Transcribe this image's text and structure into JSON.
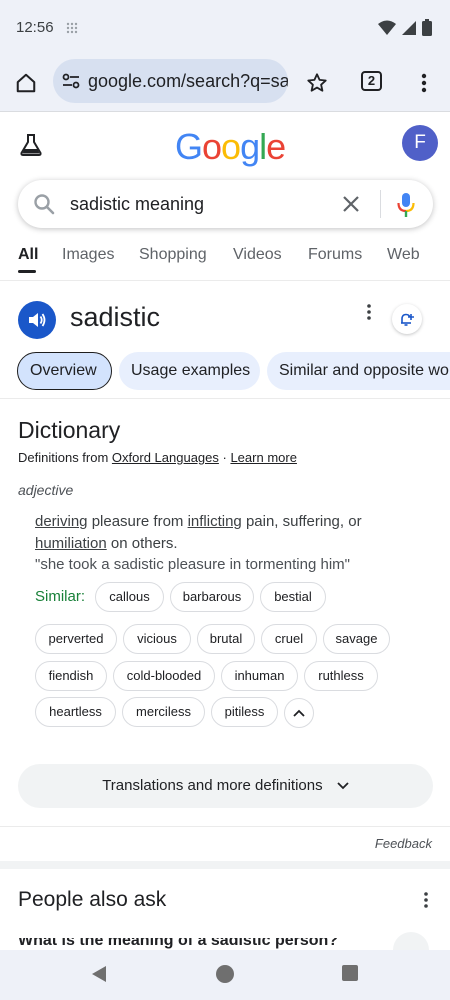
{
  "status": {
    "time": "12:56"
  },
  "browser": {
    "url": "google.com/search?q=sa",
    "tab_count": "2"
  },
  "google": {
    "logo": [
      "G",
      "o",
      "o",
      "g",
      "l",
      "e"
    ],
    "logo_colors": [
      "#4285F4",
      "#EA4335",
      "#FBBC05",
      "#4285F4",
      "#34A853",
      "#EA4335"
    ],
    "avatar_letter": "F"
  },
  "search": {
    "query": "sadistic meaning"
  },
  "tabs": [
    "All",
    "Images",
    "Shopping",
    "Videos",
    "Forums",
    "Web"
  ],
  "word": {
    "title": "sadistic",
    "chips": [
      "Overview",
      "Usage examples",
      "Similar and opposite wo"
    ]
  },
  "dictionary": {
    "title": "Dictionary",
    "source_prefix": "Definitions from ",
    "source": "Oxford Languages",
    "separator": " · ",
    "learn_more": "Learn more",
    "part_of_speech": "adjective",
    "definition": {
      "w1": "deriving",
      "t1": " pleasure from ",
      "w2": "inflicting",
      "t2": " pain, suffering, or ",
      "w3": "humiliation",
      "t3": " on others."
    },
    "example": "\"she took a sadistic pleasure in tormenting him\"",
    "similar_label": "Similar:",
    "similar": [
      "callous",
      "barbarous",
      "bestial",
      "perverted",
      "vicious",
      "brutal",
      "cruel",
      "savage",
      "fiendish",
      "cold-blooded",
      "inhuman",
      "ruthless",
      "heartless",
      "merciless",
      "pitiless"
    ],
    "more_button": "Translations and more definitions"
  },
  "feedback": "Feedback",
  "people_also_ask": {
    "title": "People also ask",
    "first_question": "What is the meaning of a sadistic person?"
  },
  "colors": {
    "accent_blue": "#1a57c9",
    "similar_green": "#188038",
    "chip_bg": "#e8effd"
  }
}
